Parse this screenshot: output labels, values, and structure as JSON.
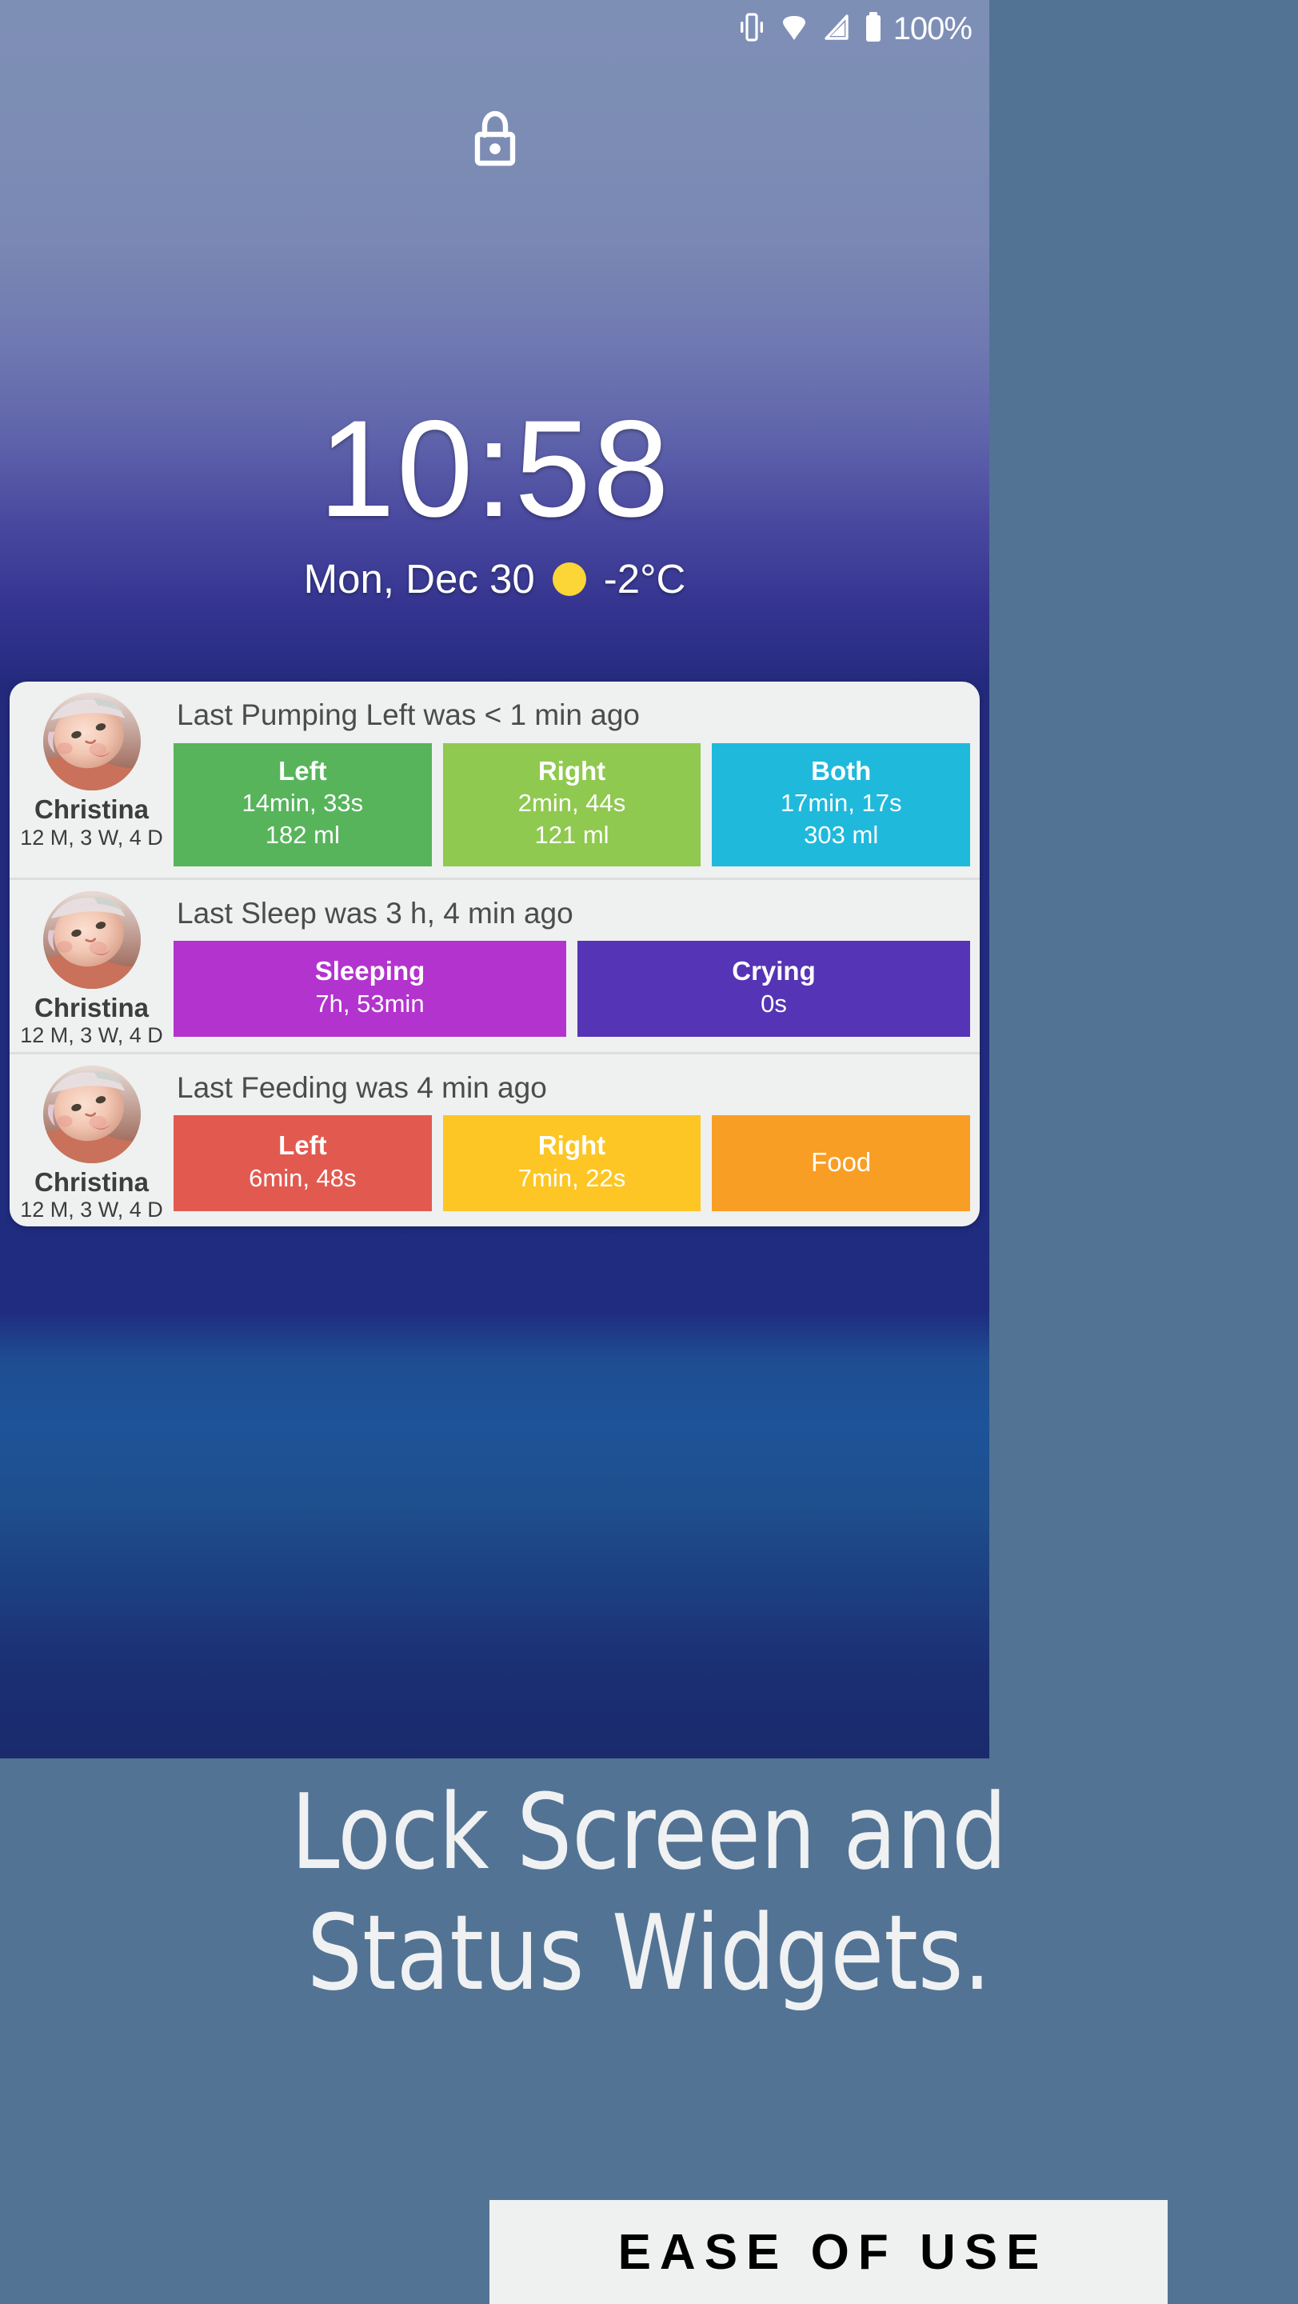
{
  "status_bar": {
    "battery_percent": "100%",
    "icons": [
      "vibrate-icon",
      "wifi-icon",
      "cell-signal-icon",
      "battery-icon"
    ]
  },
  "lock_screen": {
    "lock_icon": "lock-icon",
    "time": "10:58",
    "date": "Mon, Dec 30",
    "weather_icon": "sun-icon",
    "temperature": "-2°C"
  },
  "widget": {
    "rows": [
      {
        "title": "Last Pumping Left was < 1 min ago",
        "child": {
          "name": "Christina",
          "age": "12 M, 3 W, 4 D",
          "avatar": "baby-avatar"
        },
        "tiles": [
          {
            "label": "Left",
            "value1": "14min, 33s",
            "value2": "182 ml",
            "color": "#57b45b"
          },
          {
            "label": "Right",
            "value1": "2min, 44s",
            "value2": "121 ml",
            "color": "#8fc94f"
          },
          {
            "label": "Both",
            "value1": "17min, 17s",
            "value2": "303 ml",
            "color": "#1fb9dc"
          }
        ]
      },
      {
        "title": "Last Sleep was 3 h,  4 min ago",
        "child": {
          "name": "Christina",
          "age": "12 M, 3 W, 4 D",
          "avatar": "baby-avatar"
        },
        "tiles": [
          {
            "label": "Sleeping",
            "value1": "7h, 53min",
            "value2": "",
            "color": "#b333ce"
          },
          {
            "label": "Crying",
            "value1": "0s",
            "value2": "",
            "color": "#5534b5"
          }
        ]
      },
      {
        "title": "Last Feeding was  4 min ago",
        "child": {
          "name": "Christina",
          "age": "12 M, 3 W, 4 D",
          "avatar": "baby-avatar"
        },
        "tiles": [
          {
            "label": "Left",
            "value1": "6min, 48s",
            "value2": "",
            "color": "#e25a4f"
          },
          {
            "label": "Right",
            "value1": "7min, 22s",
            "value2": "",
            "color": "#fdc625"
          },
          {
            "label": "Food",
            "value1": "",
            "value2": "",
            "color": "#f99e24",
            "plain": true
          }
        ]
      }
    ]
  },
  "caption": {
    "line1": "Lock Screen and",
    "line2": "Status Widgets."
  },
  "badge": {
    "text": "EASE OF USE"
  },
  "colors": {
    "page_background": "#527394",
    "card_background": "#eff0f0",
    "accent_sun": "#fcd536"
  }
}
